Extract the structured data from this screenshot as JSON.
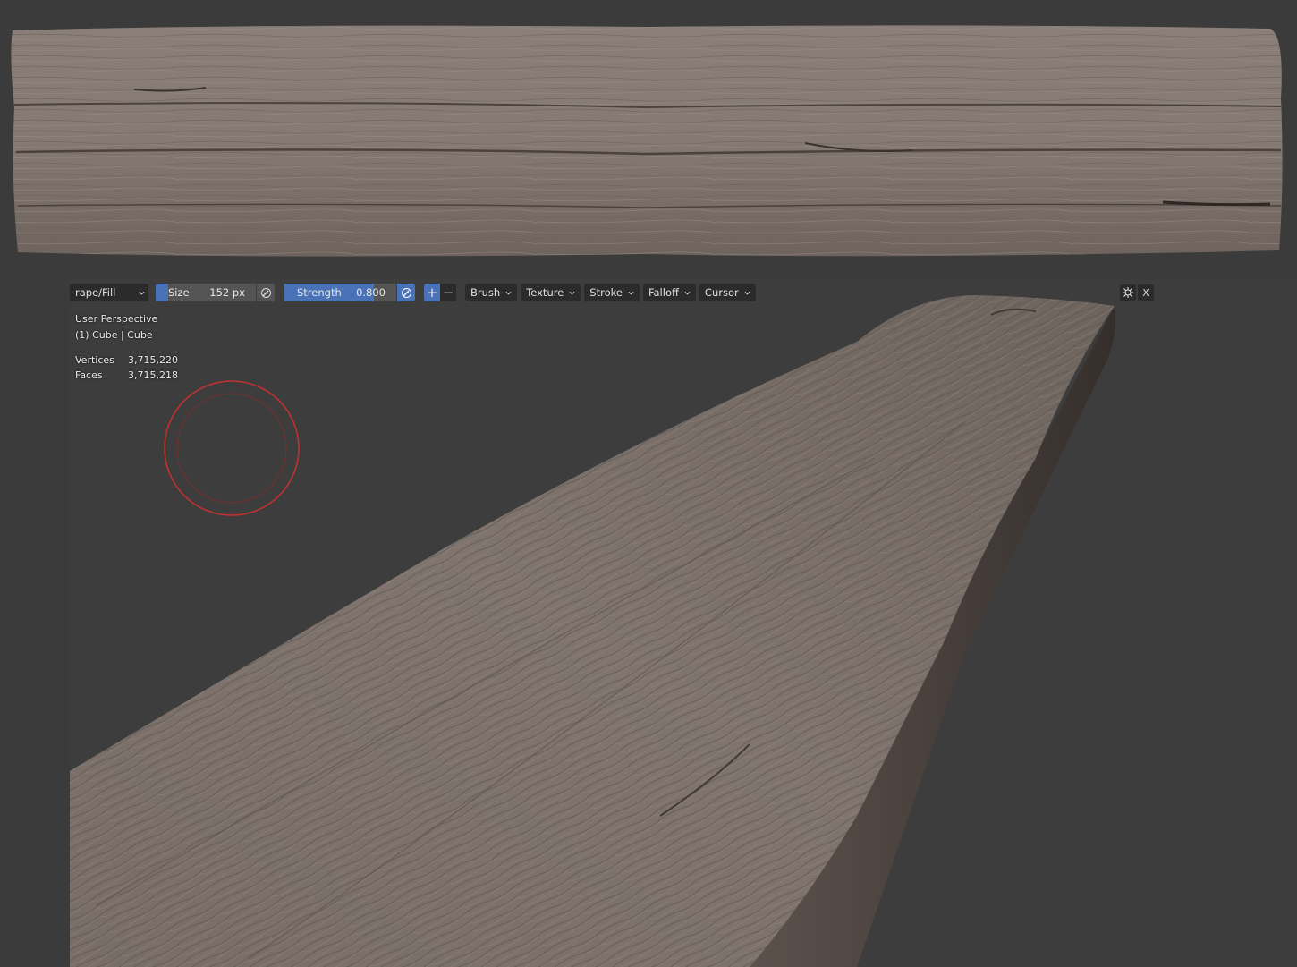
{
  "viewport": {
    "view_name": "User Perspective",
    "object_info": "(1) Cube | Cube",
    "stats": [
      {
        "label": "Vertices",
        "value": "3,715,220"
      },
      {
        "label": "Faces",
        "value": "3,715,218"
      }
    ]
  },
  "toolbar": {
    "brush_name": "rape/Fill",
    "size_label": "Size",
    "size_value": "152 px",
    "strength_label": "Strength",
    "strength_value": "0.800",
    "strength_fraction": 0.8,
    "plus_label": "+",
    "minus_label": "−",
    "menus": [
      "Brush",
      "Texture",
      "Stroke",
      "Falloff",
      "Cursor"
    ]
  },
  "right_buttons": {
    "close_label": "X",
    "gizmo_icon": "gizmo-icon"
  },
  "colors": {
    "accent": "#4a72b8",
    "wood": "#7d716b",
    "background": "#3b3b3b",
    "brush_ring": "#c0322f"
  }
}
